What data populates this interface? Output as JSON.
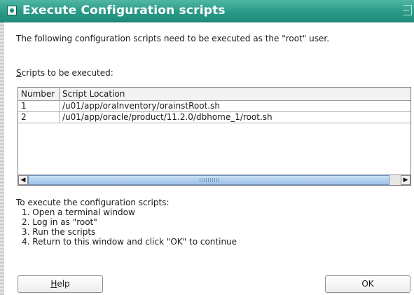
{
  "window": {
    "title": "Execute Configuration scripts"
  },
  "intro_text": "The following configuration scripts need to be executed as the \"root\" user.",
  "scripts_label": {
    "mnemonic": "S",
    "rest": "cripts to be executed:"
  },
  "table": {
    "columns": [
      "Number",
      "Script Location"
    ],
    "rows": [
      {
        "number": "1",
        "location": "/u01/app/oraInventory/orainstRoot.sh"
      },
      {
        "number": "2",
        "location": "/u01/app/oracle/product/11.2.0/dbhome_1/root.sh"
      }
    ]
  },
  "scrollbar": {
    "left_arrow": "◀",
    "right_arrow": "▶"
  },
  "instructions": {
    "heading": "To execute the configuration scripts:",
    "steps": [
      "1. Open a terminal window",
      "2. Log in as \"root\"",
      "3. Run the scripts",
      "4. Return to this window and click \"OK\" to continue"
    ]
  },
  "buttons": {
    "help_mnemonic": "H",
    "help_rest": "elp",
    "ok": "OK"
  },
  "colors": {
    "titlebar": "#2a9a87",
    "scroll_thumb": "#9dc2e8"
  },
  "icons": {
    "title": "window-menu-icon",
    "corner": "window-corner-icon"
  }
}
